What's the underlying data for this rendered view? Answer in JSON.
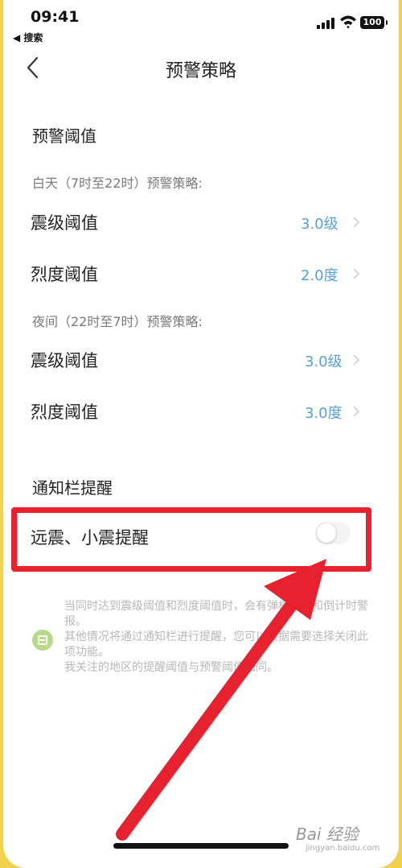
{
  "status_bar": {
    "time": "09:41",
    "back_app": "◀ 搜索",
    "battery": "100"
  },
  "nav": {
    "title": "预警策略"
  },
  "threshold_section": {
    "title": "预警阈值",
    "day": {
      "label": "白天（7时至22时）预警策略:",
      "magnitude": {
        "label": "震级阈值",
        "value": "3.0级"
      },
      "intensity": {
        "label": "烈度阈值",
        "value": "2.0度"
      }
    },
    "night": {
      "label": "夜间（22时至7时）预警策略:",
      "magnitude": {
        "label": "震级阈值",
        "value": "3.0级"
      },
      "intensity": {
        "label": "烈度阈值",
        "value": "3.0度"
      }
    }
  },
  "notify_section": {
    "title": "通知栏提醒",
    "toggle_label": "远震、小震提醒",
    "toggle_on": false
  },
  "notes": {
    "line1": "当同时达到震级阈值和烈度阈值时，会有弹框提示和倒计时警报。",
    "line2": "其他情况将通过通知栏进行提醒，您可以根据需要选择关闭此项功能。",
    "line3": "我关注的地区的提醒阈值与预警阈值相同。"
  },
  "watermark": {
    "text": "Bai 经验",
    "url": "jingyan.baidu.com"
  },
  "colors": {
    "accent_value": "#5aa0e0",
    "highlight_red": "#e8212f",
    "background_yellow": "#f0d24e"
  }
}
